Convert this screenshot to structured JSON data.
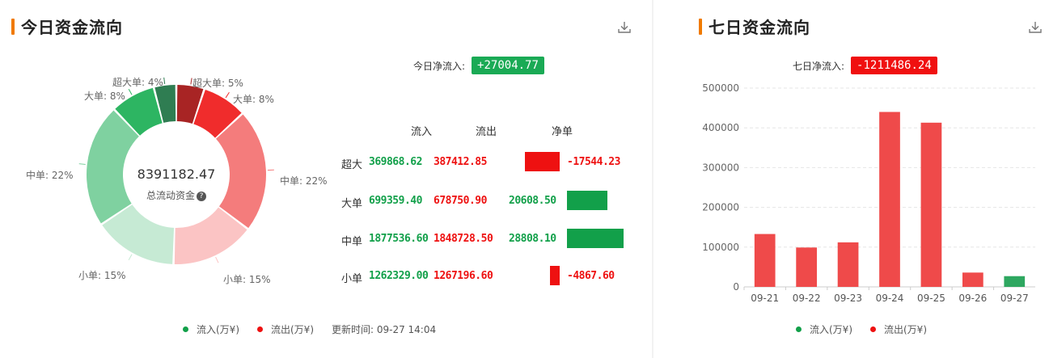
{
  "today": {
    "title": "今日资金流向",
    "net_label": "今日净流入:",
    "net_value": "+27004.77",
    "total_value": "8391182.47",
    "total_label": "总流动资金",
    "segments": [
      {
        "label": "超大单: 5%",
        "pct": 5,
        "color": "#a82424"
      },
      {
        "label": "大单: 8%",
        "pct": 8,
        "color": "#f02c2c"
      },
      {
        "label": "中单: 22%",
        "pct": 22,
        "color": "#f47c7c"
      },
      {
        "label": "小单: 15%",
        "pct": 15,
        "color": "#fbc4c4"
      },
      {
        "label": "小单: 15%",
        "pct": 15,
        "color": "#c6ead4"
      },
      {
        "label": "中单: 22%",
        "pct": 22,
        "color": "#7fd1a0"
      },
      {
        "label": "大单: 8%",
        "pct": 8,
        "color": "#2db562"
      },
      {
        "label": "超大单: 4%",
        "pct": 4,
        "color": "#2f7d52"
      }
    ],
    "headers": {
      "in": "流入",
      "out": "流出",
      "net": "净单"
    },
    "rows": [
      {
        "label": "超大",
        "in": "369868.62",
        "out": "387412.85",
        "net": "-17544.23",
        "net_num": -17544.23
      },
      {
        "label": "大单",
        "in": "699359.40",
        "out": "678750.90",
        "net": "20608.50",
        "net_num": 20608.5
      },
      {
        "label": "中单",
        "in": "1877536.60",
        "out": "1848728.50",
        "net": "28808.10",
        "net_num": 28808.1
      },
      {
        "label": "小单",
        "in": "1262329.00",
        "out": "1267196.60",
        "net": "-4867.60",
        "net_num": -4867.6
      }
    ],
    "legend": {
      "in": "流入(万¥)",
      "out": "流出(万¥)"
    },
    "update_time": "更新时间: 09-27 14:04"
  },
  "seven": {
    "title": "七日资金流向",
    "net_label": "七日净流入:",
    "net_value": "-1211486.24",
    "legend": {
      "in": "流入(万¥)",
      "out": "流出(万¥)"
    }
  },
  "colors": {
    "in": "#12a04a",
    "out": "#ee1111",
    "accent": "#f07a00",
    "bar_out": "#ef4a4a",
    "bar_in": "#2ea760"
  },
  "icons": {
    "download": "download-icon",
    "help": "help-icon"
  },
  "chart_data": {
    "type": "bar",
    "categories": [
      "09-21",
      "09-22",
      "09-23",
      "09-24",
      "09-25",
      "09-26",
      "09-27"
    ],
    "values": [
      133000,
      99000,
      112000,
      440000,
      413000,
      36000,
      27000
    ],
    "directions": [
      "out",
      "out",
      "out",
      "out",
      "out",
      "out",
      "in"
    ],
    "yticks": [
      "0",
      "100000",
      "200000",
      "300000",
      "400000",
      "500000"
    ],
    "ylim": [
      0,
      500000
    ]
  }
}
